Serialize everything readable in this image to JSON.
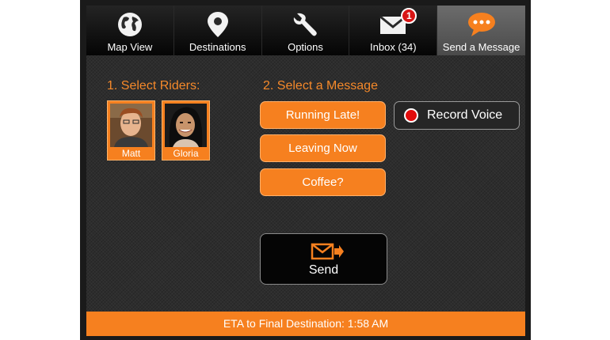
{
  "tabs": [
    {
      "label": "Map View",
      "icon": "globe-icon"
    },
    {
      "label": "Destinations",
      "icon": "map-pin-icon"
    },
    {
      "label": "Options",
      "icon": "wrench-icon"
    },
    {
      "label": "Inbox (34)",
      "icon": "envelope-icon",
      "badge": "1"
    },
    {
      "label": "Send a Message",
      "icon": "chat-bubble-icon",
      "active": true
    }
  ],
  "riders": {
    "heading": "1. Select Riders:",
    "items": [
      {
        "name": "Matt"
      },
      {
        "name": "Gloria"
      }
    ]
  },
  "message": {
    "heading": "2. Select a Message",
    "options": [
      "Running Late!",
      "Leaving Now",
      "Coffee?"
    ],
    "record_label": "Record Voice"
  },
  "send": {
    "label": "Send",
    "icon": "send-envelope-icon"
  },
  "eta": "ETA to Final Destination: 1:58 AM",
  "colors": {
    "accent": "#f6801f",
    "heading": "#f5892a",
    "record": "#e10c0c",
    "badge": "#d81414"
  }
}
